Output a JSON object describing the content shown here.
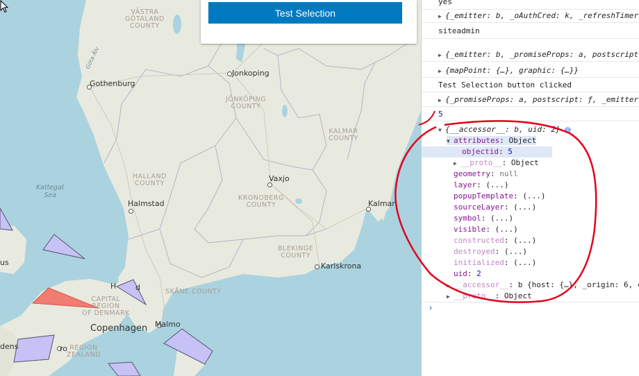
{
  "map": {
    "button_label": "Test Selection",
    "cities": [
      {
        "name": "Gothenburg"
      },
      {
        "name": "Jonkoping"
      },
      {
        "name": "Vaxjo"
      },
      {
        "name": "Halmstad"
      },
      {
        "name": "Kalmar"
      },
      {
        "name": "Karlskrona"
      },
      {
        "name": "Malmo"
      },
      {
        "name": "Copenhagen"
      },
      {
        "name": "Helsingør fragment",
        "text": "H"
      },
      {
        "name": "Helsingør end fragment",
        "text": "d"
      }
    ],
    "regions": [
      {
        "text": "VÄSTRA\nGÖTALAND\nCOUNTY"
      },
      {
        "text": "JÖNKÖPING\nCOUNTY"
      },
      {
        "text": "KALMAR\nCOUNTY"
      },
      {
        "text": "HALLAND\nCOUNTY"
      },
      {
        "text": "KRONOBERG\nCOUNTY"
      },
      {
        "text": "BLEKINGE\nCOUNTY"
      },
      {
        "text": "SKÅNE COUNTY"
      },
      {
        "text": "CAPITAL\nREGION\nOF DENMARK"
      },
      {
        "text": "REGION\nZEALAND"
      }
    ],
    "water_labels": [
      {
        "text": "Kattegat\nSea"
      },
      {
        "text": "Göta Älv"
      }
    ],
    "edge_labels": [
      {
        "text": "us"
      },
      {
        "text": "dens"
      },
      {
        "text": "ro"
      }
    ],
    "polygon_colors": {
      "purple_fill": "#c7c2f5",
      "purple_stroke": "#55506e",
      "red_fill": "#f07c72"
    }
  },
  "console": {
    "lines": [
      {
        "text": "yes"
      },
      {
        "text": "{_emitter: b, _oAuthCred: k, _refreshTimer"
      },
      {
        "text": "siteadmin"
      },
      {
        "text": "{_emitter: b, _promiseProps: a, postscript"
      },
      {
        "text": "{mapPoint: {…}, graphic: {…}}"
      },
      {
        "text": "Test Selection button clicked"
      },
      {
        "text": "{_promiseProps: a, postscript: ƒ, _emitter"
      },
      {
        "text": "5"
      },
      {
        "text": "{__accessor__: b, uid: 2}"
      },
      {
        "key": "attributes",
        "value": "Object"
      },
      {
        "key": "objectid",
        "value": "5"
      },
      {
        "key": "__proto__",
        "value": "Object"
      },
      {
        "key": "geometry",
        "value": "null"
      },
      {
        "key": "layer",
        "value": "(...)"
      },
      {
        "key": "popupTemplate",
        "value": "(...)"
      },
      {
        "key": "sourceLayer",
        "value": "(...)"
      },
      {
        "key": "symbol",
        "value": "(...)"
      },
      {
        "key": "visible",
        "value": "(...)"
      },
      {
        "key": "constructed",
        "value": "(...)"
      },
      {
        "key": "destroyed",
        "value": "(...)"
      },
      {
        "key": "initialized",
        "value": "(...)"
      },
      {
        "key": "uid",
        "value": "2"
      },
      {
        "key": "__accessor__",
        "value": "b {host: {…}, _origin: 6, c"
      },
      {
        "key": "__proto__",
        "value": "Object"
      }
    ],
    "prompt_symbol": "›",
    "annotation_color": "#e3001b"
  }
}
